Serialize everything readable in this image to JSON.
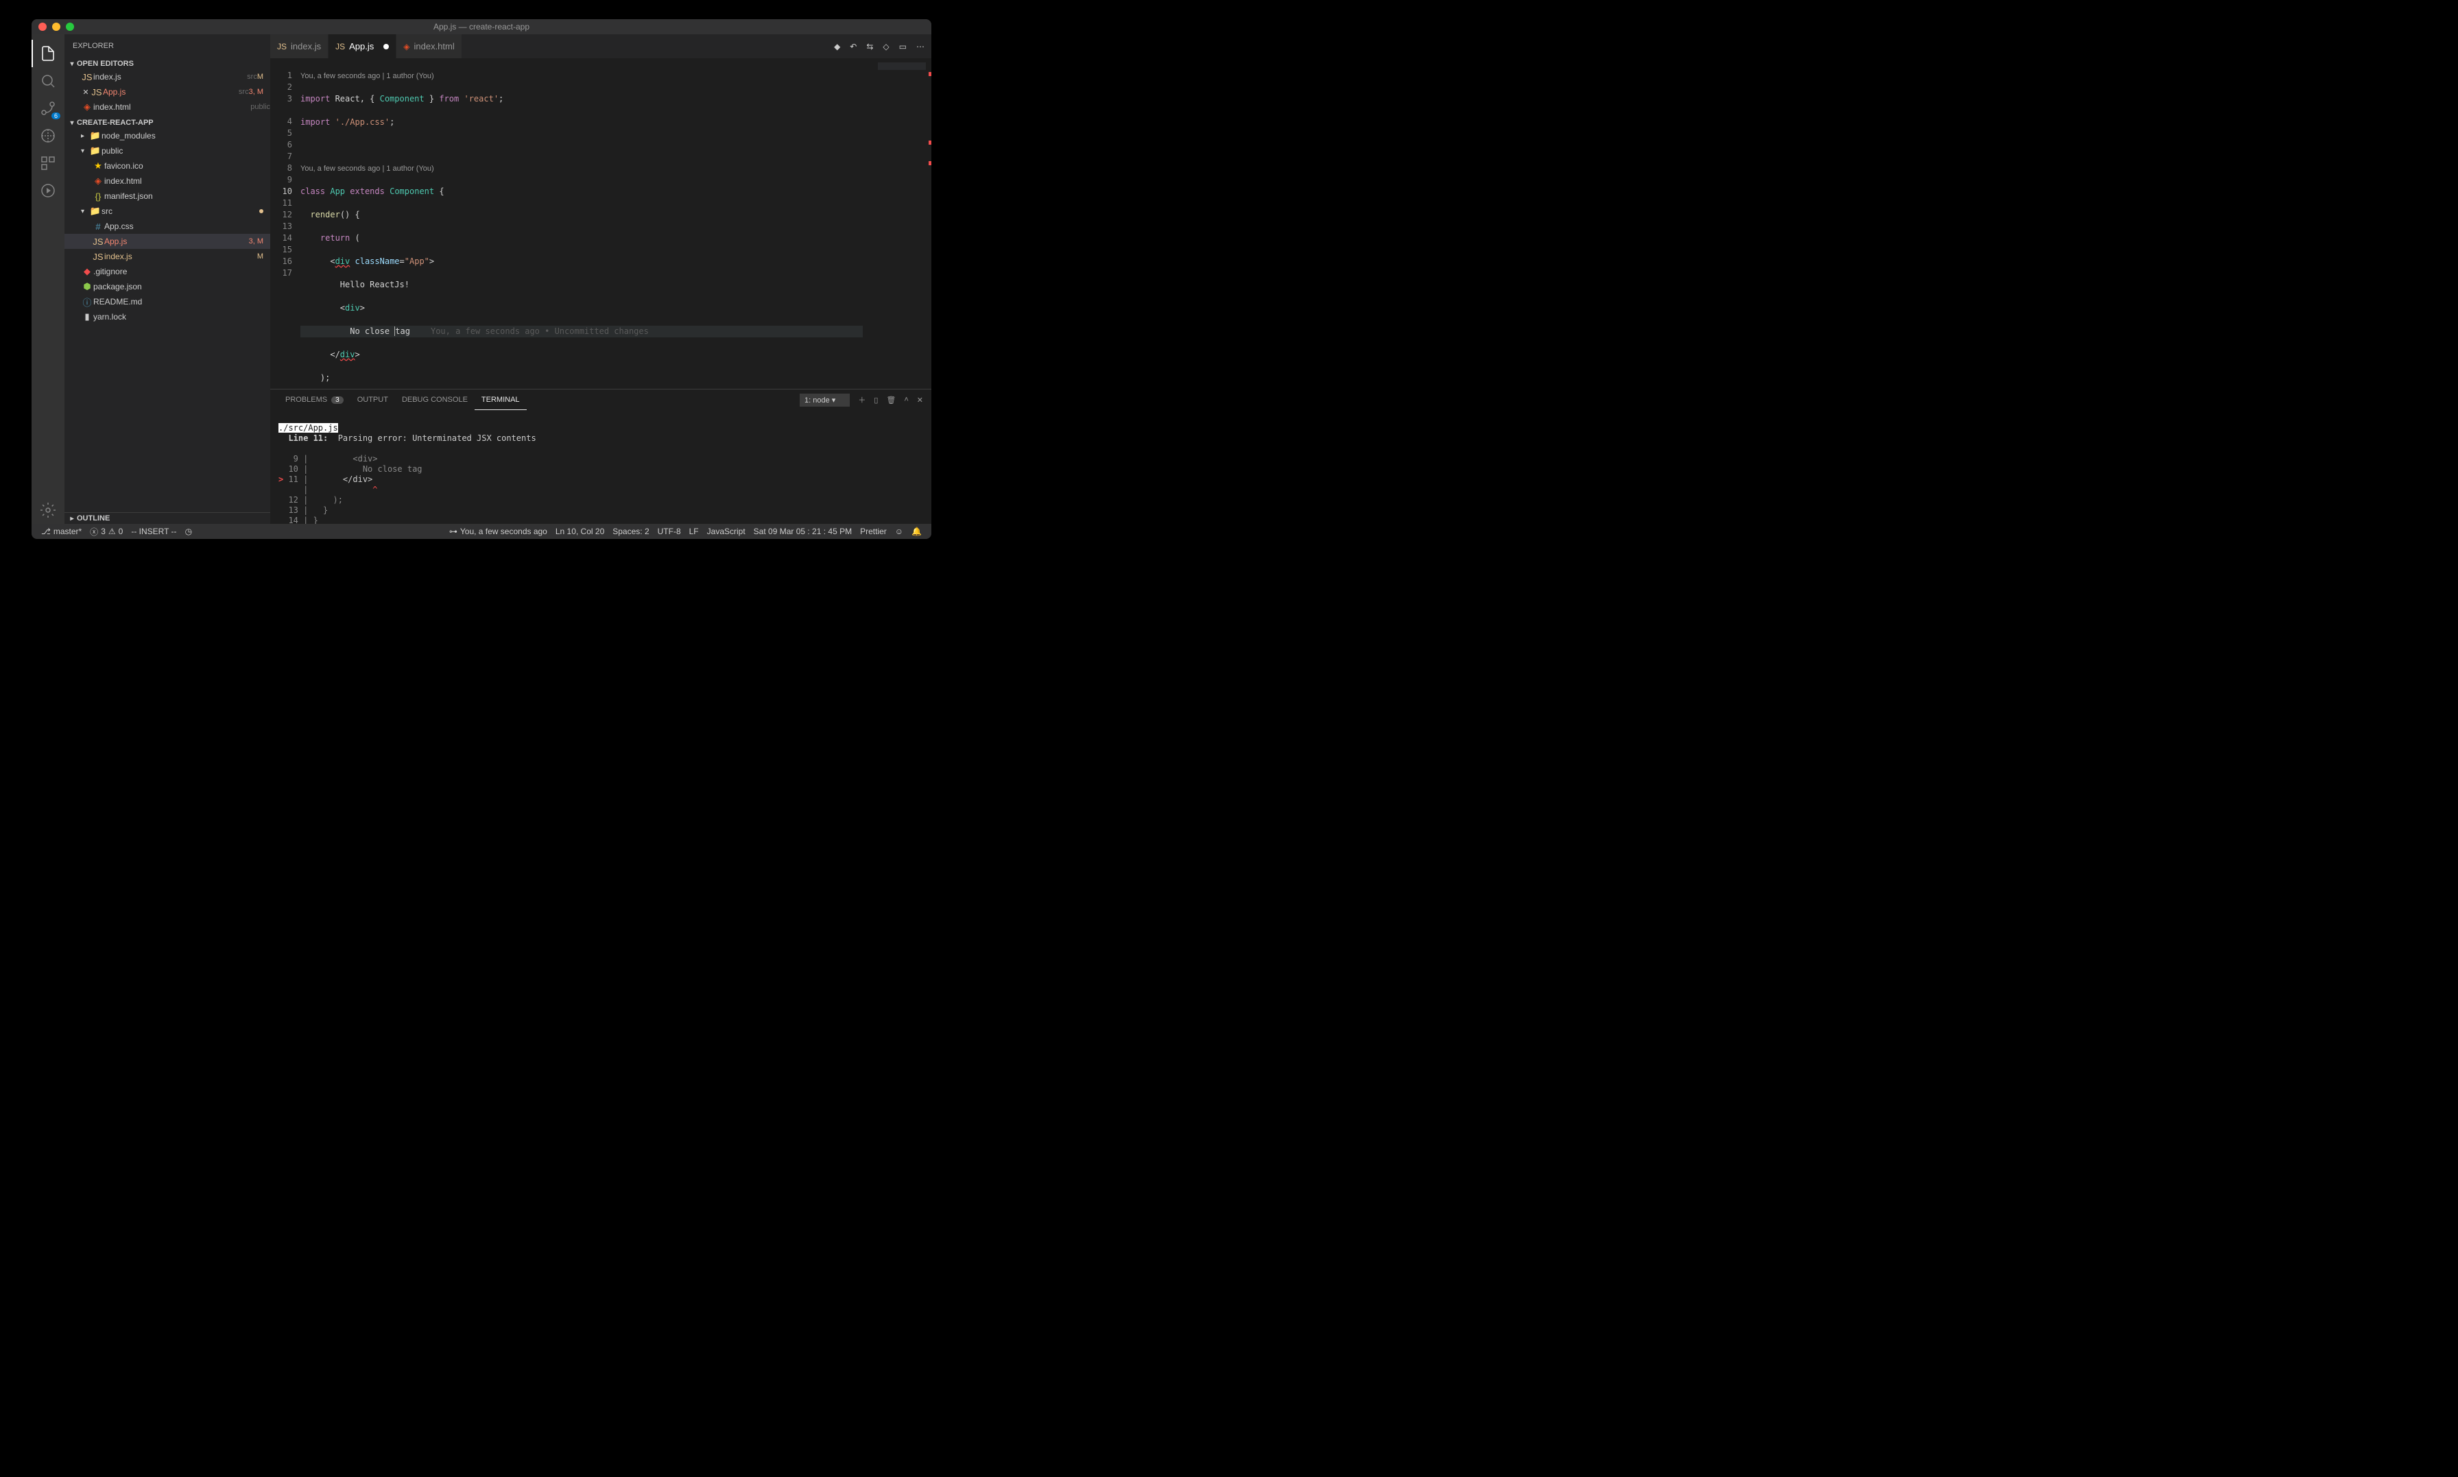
{
  "title": "App.js — create-react-app",
  "sidebar": {
    "header": "EXPLORER",
    "open_editors_label": "OPEN EDITORS",
    "open_editors": [
      {
        "name": "index.js",
        "path": "src",
        "status": "M"
      },
      {
        "name": "App.js",
        "path": "src",
        "status": "3, M",
        "dirty": true
      },
      {
        "name": "index.html",
        "path": "public",
        "status": ""
      }
    ],
    "project_label": "CREATE-REACT-APP",
    "tree": [
      {
        "type": "folder",
        "name": "node_modules",
        "depth": 1,
        "icon": "node"
      },
      {
        "type": "folder",
        "name": "public",
        "depth": 1,
        "open": true,
        "icon": "folder"
      },
      {
        "type": "file",
        "name": "favicon.ico",
        "depth": 2,
        "icon": "star"
      },
      {
        "type": "file",
        "name": "index.html",
        "depth": 2,
        "icon": "html"
      },
      {
        "type": "file",
        "name": "manifest.json",
        "depth": 2,
        "icon": "json"
      },
      {
        "type": "folder",
        "name": "src",
        "depth": 1,
        "open": true,
        "icon": "folder",
        "modified": true
      },
      {
        "type": "file",
        "name": "App.css",
        "depth": 2,
        "icon": "css"
      },
      {
        "type": "file",
        "name": "App.js",
        "depth": 2,
        "icon": "js",
        "status": "3, M",
        "selected": true
      },
      {
        "type": "file",
        "name": "index.js",
        "depth": 2,
        "icon": "js",
        "status": "M"
      },
      {
        "type": "file",
        "name": ".gitignore",
        "depth": 1,
        "icon": "git"
      },
      {
        "type": "file",
        "name": "package.json",
        "depth": 1,
        "icon": "node"
      },
      {
        "type": "file",
        "name": "README.md",
        "depth": 1,
        "icon": "md"
      },
      {
        "type": "file",
        "name": "yarn.lock",
        "depth": 1,
        "icon": "lock"
      }
    ],
    "outline_label": "OUTLINE"
  },
  "tabs": [
    {
      "name": "index.js",
      "icon": "js"
    },
    {
      "name": "App.js",
      "icon": "js",
      "active": true,
      "dirty": true
    },
    {
      "name": "index.html",
      "icon": "html"
    }
  ],
  "editor": {
    "codelens1": "You, a few seconds ago | 1 author (You)",
    "codelens2": "You, a few seconds ago | 1 author (You)",
    "blame_inline": "You, a few seconds ago • Uncommitted changes",
    "lines": 17,
    "current_line": 10
  },
  "panel": {
    "tabs": {
      "problems": "PROBLEMS",
      "problems_count": "3",
      "output": "OUTPUT",
      "debug_console": "DEBUG CONSOLE",
      "terminal": "TERMINAL"
    },
    "terminal_select": "1: node",
    "terminal": {
      "file_hl": "./src/App.js",
      "line_label": "  Line 11:",
      "error_msg": "  Parsing error: Unterminated JSX contents",
      "l1": "   9 |         <div>",
      "l2": "  10 |           No close tag",
      "l3p": "> ",
      "l3": "11 | ",
      "l3code": "      </div>",
      "l4": "     |             ",
      "caret": "^",
      "l5": "  12 |     );",
      "l6": "  13 |   }",
      "l7": "  14 | }"
    }
  },
  "statusbar": {
    "branch": "master*",
    "errors": "3",
    "warnings": "0",
    "vim_mode": "-- INSERT --",
    "blame": "You, a few seconds ago",
    "position": "Ln 10, Col 20",
    "spaces": "Spaces: 2",
    "encoding": "UTF-8",
    "eol": "LF",
    "language": "JavaScript",
    "date": "Sat 09 Mar 05 : 21 : 45 PM",
    "prettier": "Prettier"
  },
  "scm_badge": "6"
}
